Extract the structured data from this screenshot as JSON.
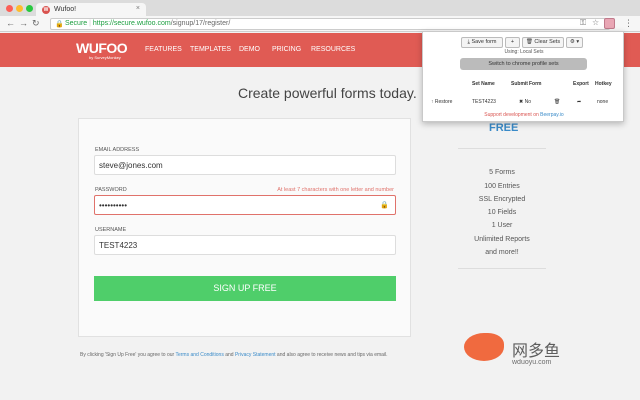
{
  "browser": {
    "tab_title": "Wufoo!",
    "tab_favicon": "W",
    "url_secure": "Secure",
    "url_domain": "https://secure.wufoo.com",
    "url_path": "/signup/17/register/"
  },
  "header": {
    "logo": "WUFOO",
    "logo_sub": "by SurveyMonkey",
    "nav": [
      "FEATURES",
      "TEMPLATES",
      "DEMO",
      "PRICING",
      "RESOURCES"
    ],
    "color": "#e05b54"
  },
  "hero": "Create powerful forms today.",
  "form": {
    "email_label": "EMAIL ADDRESS",
    "email_value": "steve@jones.com",
    "password_label": "PASSWORD",
    "password_hint": "At least 7 characters with one letter and number",
    "password_value": "••••••••••",
    "username_label": "USERNAME",
    "username_value": "TEST4223",
    "submit_label": "SIGN UP FREE",
    "terms_prefix": "By clicking 'Sign Up Free' you agree to our ",
    "terms_link": "Terms and Conditions",
    "terms_mid": " and ",
    "privacy_link": "Privacy Statement",
    "terms_suffix": " and also agree to receive news and tips via email."
  },
  "plan": {
    "heading": "FREE",
    "features": [
      "5 Forms",
      "100 Entries",
      "SSL Encrypted",
      "10 Fields",
      "1 User",
      "Unlimited Reports",
      "and more!!"
    ]
  },
  "popup": {
    "save_form": "Save form",
    "add": "+",
    "clear_sets": "Clear Sets",
    "settings": "⚙ ▾",
    "using": "Using: Local Sets",
    "switch": "Switch to chrome profile sets",
    "columns": [
      "Set Name",
      "Submit",
      "Form",
      "Export",
      "Hotkey"
    ],
    "row": {
      "restore": "Restore",
      "set_name": "TEST4223",
      "submit": "No",
      "hotkey": "none"
    },
    "support_prefix": "Support development on ",
    "support_link": "Beerpay.io"
  },
  "watermark": {
    "text": "网多鱼",
    "sub": "wduoyu.com"
  }
}
